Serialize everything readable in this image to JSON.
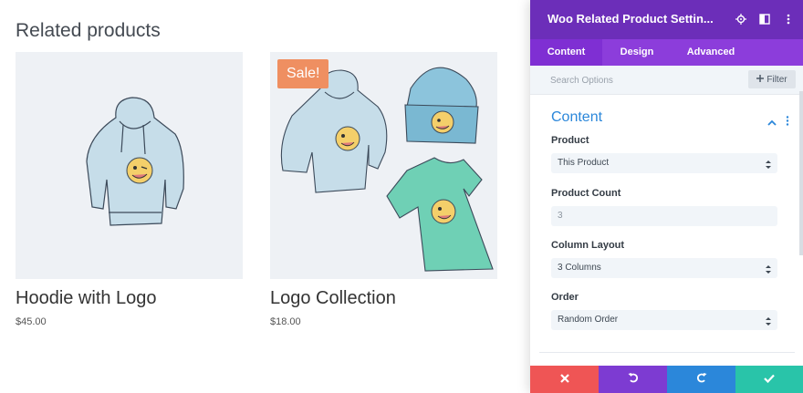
{
  "related": {
    "heading": "Related products",
    "products": [
      {
        "title": "Hoodie with Logo",
        "price": "$45.00",
        "sale": ""
      },
      {
        "title": "Logo Collection",
        "price": "$18.00",
        "sale": "Sale!"
      }
    ]
  },
  "panel": {
    "title": "Woo Related Product Settin...",
    "header_icons": [
      "target-icon",
      "split-view-icon",
      "more-vertical-icon"
    ],
    "tabs": [
      {
        "label": "Content",
        "active": true
      },
      {
        "label": "Design",
        "active": false
      },
      {
        "label": "Advanced",
        "active": false
      }
    ],
    "search": {
      "placeholder": "Search Options",
      "filter_label": "Filter"
    },
    "section": {
      "title": "Content",
      "expanded": true
    },
    "fields": {
      "product": {
        "label": "Product",
        "value": "This Product"
      },
      "product_count": {
        "label": "Product Count",
        "placeholder": "3"
      },
      "column_layout": {
        "label": "Column Layout",
        "value": "3 Columns"
      },
      "order": {
        "label": "Order",
        "value": "Random Order"
      }
    },
    "footer": {
      "discard": "close-icon",
      "undo": "undo-icon",
      "redo": "redo-icon",
      "save": "checkmark-icon"
    }
  },
  "colors": {
    "header_purple": "#6c2eb9",
    "tabs_purple": "#8c3ddb",
    "accent_blue": "#2b87da",
    "sale_orange": "#ef8f61",
    "discard_red": "#ef5555",
    "save_green": "#29c4a9"
  }
}
